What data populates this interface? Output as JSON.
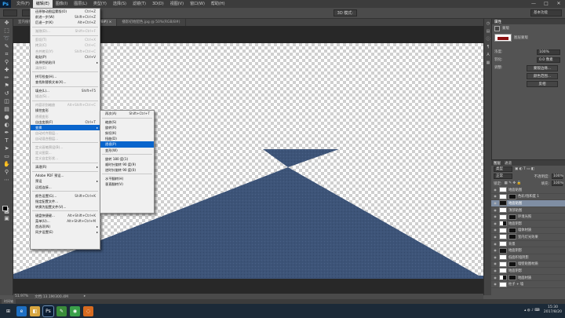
{
  "app": {
    "logo": "Ps"
  },
  "menubar": {
    "items": [
      "文件(F)",
      "编辑(E)",
      "图像(I)",
      "图层(L)",
      "类型(Y)",
      "选择(S)",
      "滤镜(T)",
      "3D(D)",
      "视图(V)",
      "窗口(W)",
      "帮助(H)"
    ],
    "active_index": 1,
    "window_buttons": [
      "—",
      "□",
      "✕"
    ]
  },
  "options_bar": {
    "mode_label": "3D 模式:",
    "workspace": "基本功能"
  },
  "doc_tabs": [
    {
      "label": "室内植物 @ 50% (RGB/8#)",
      "active": false
    },
    {
      "label": "@ 55.5% (RGB/8#) ×",
      "active": true
    },
    {
      "label": "播影初始配色.jpg @ 50%(RGB/8#)",
      "active": false
    }
  ],
  "edit_menu": [
    {
      "label": "还原移动图层蒙版(O)",
      "shortcut": "Ctrl+Z",
      "enabled": true
    },
    {
      "label": "前进一步(W)",
      "shortcut": "Shift+Ctrl+Z",
      "enabled": true
    },
    {
      "label": "后退一步(K)",
      "shortcut": "Alt+Ctrl+Z",
      "enabled": true
    },
    {
      "sep": true
    },
    {
      "label": "渐隐(D)...",
      "shortcut": "Shift+Ctrl+F",
      "enabled": false
    },
    {
      "sep": true
    },
    {
      "label": "剪切(T)",
      "shortcut": "Ctrl+X",
      "enabled": false
    },
    {
      "label": "拷贝(C)",
      "shortcut": "Ctrl+C",
      "enabled": false
    },
    {
      "label": "合并拷贝(Y)",
      "shortcut": "Shift+Ctrl+C",
      "enabled": false
    },
    {
      "label": "粘贴(P)",
      "shortcut": "Ctrl+V",
      "enabled": true
    },
    {
      "label": "选择性粘贴(I)",
      "shortcut": "",
      "enabled": true,
      "submenu": true
    },
    {
      "label": "清除(E)",
      "shortcut": "",
      "enabled": false
    },
    {
      "sep": true
    },
    {
      "label": "拼写检查(H)...",
      "shortcut": "",
      "enabled": true
    },
    {
      "label": "查找和替换文本(X)...",
      "shortcut": "",
      "enabled": true
    },
    {
      "sep": true
    },
    {
      "label": "填充(L)...",
      "shortcut": "Shift+F5",
      "enabled": true
    },
    {
      "label": "描边(S)...",
      "shortcut": "",
      "enabled": false
    },
    {
      "sep": true
    },
    {
      "label": "内容识别缩放",
      "shortcut": "Alt+Shift+Ctrl+C",
      "enabled": false
    },
    {
      "label": "操控变形",
      "shortcut": "",
      "enabled": true
    },
    {
      "label": "透视变形",
      "shortcut": "",
      "enabled": false
    },
    {
      "label": "自由变换(F)",
      "shortcut": "Ctrl+T",
      "enabled": true
    },
    {
      "label": "变换",
      "shortcut": "",
      "enabled": true,
      "submenu": true,
      "highlighted": true
    },
    {
      "label": "自动对齐图层...",
      "shortcut": "",
      "enabled": false
    },
    {
      "label": "自动混合图层...",
      "shortcut": "",
      "enabled": false
    },
    {
      "sep": true
    },
    {
      "label": "定义画笔预设(B)...",
      "shortcut": "",
      "enabled": false
    },
    {
      "label": "定义图案...",
      "shortcut": "",
      "enabled": false
    },
    {
      "label": "定义自定形状...",
      "shortcut": "",
      "enabled": false
    },
    {
      "sep": true
    },
    {
      "label": "清理(R)",
      "shortcut": "",
      "enabled": true,
      "submenu": true
    },
    {
      "sep": true
    },
    {
      "label": "Adobe PDF 预设...",
      "shortcut": "",
      "enabled": true
    },
    {
      "label": "预设",
      "shortcut": "",
      "enabled": true,
      "submenu": true
    },
    {
      "label": "远程连接...",
      "shortcut": "",
      "enabled": true
    },
    {
      "sep": true
    },
    {
      "label": "颜色设置(G)...",
      "shortcut": "Shift+Ctrl+K",
      "enabled": true
    },
    {
      "label": "指定配置文件...",
      "shortcut": "",
      "enabled": true
    },
    {
      "label": "转换为配置文件(V)...",
      "shortcut": "",
      "enabled": true
    },
    {
      "sep": true
    },
    {
      "label": "键盘快捷键...",
      "shortcut": "Alt+Shift+Ctrl+K",
      "enabled": true
    },
    {
      "label": "菜单(U)...",
      "shortcut": "Alt+Shift+Ctrl+M",
      "enabled": true
    },
    {
      "label": "首选项(N)",
      "shortcut": "",
      "enabled": true,
      "submenu": true
    },
    {
      "label": "同步设置(E)",
      "shortcut": "",
      "enabled": true,
      "submenu": true
    }
  ],
  "transform_submenu": [
    {
      "label": "再次(A)",
      "shortcut": "Shift+Ctrl+T",
      "enabled": true
    },
    {
      "sep": true
    },
    {
      "label": "缩放(S)",
      "shortcut": "",
      "enabled": true
    },
    {
      "label": "旋转(R)",
      "shortcut": "",
      "enabled": true
    },
    {
      "label": "斜切(K)",
      "shortcut": "",
      "enabled": true
    },
    {
      "label": "扭曲(D)",
      "shortcut": "",
      "enabled": true
    },
    {
      "label": "透视(P)",
      "shortcut": "",
      "enabled": true,
      "highlighted": true
    },
    {
      "label": "变形(W)",
      "shortcut": "",
      "enabled": true
    },
    {
      "sep": true
    },
    {
      "label": "旋转 180 度(1)",
      "shortcut": "",
      "enabled": true
    },
    {
      "label": "顺时针旋转 90 度(9)",
      "shortcut": "",
      "enabled": true
    },
    {
      "label": "逆时针旋转 90 度(0)",
      "shortcut": "",
      "enabled": true
    },
    {
      "sep": true
    },
    {
      "label": "水平翻转(H)",
      "shortcut": "",
      "enabled": true
    },
    {
      "label": "垂直翻转(V)",
      "shortcut": "",
      "enabled": true
    }
  ],
  "properties_panel": {
    "title": "属性",
    "mask_label": "蒙版",
    "layer_mask_label": "图层蒙版",
    "density_label": "浓度:",
    "density_value": "100%",
    "feather_label": "羽化:",
    "feather_value": "0.0 像素",
    "refine_label": "调整:",
    "buttons": [
      "蒙版边缘...",
      "颜色范围...",
      "反相"
    ]
  },
  "layers_panel": {
    "tabs": [
      "图层",
      "通道"
    ],
    "kind_label": "类型",
    "blend_mode": "正常",
    "opacity_label": "不透明度:",
    "opacity": "100%",
    "lock_label": "锁定:",
    "fill_label": "填充:",
    "fill": "100%",
    "layers": [
      {
        "name": "地面贴图",
        "thumb": "light",
        "mask": false,
        "selected": false
      },
      {
        "name": "色彩/饱和度 1",
        "thumb": "light",
        "mask": true,
        "selected": false
      },
      {
        "name": "地面贴图",
        "thumb": "dark",
        "mask": false,
        "selected": true
      },
      {
        "name": "顶部贴图",
        "thumb": "light",
        "mask": false,
        "selected": false
      },
      {
        "name": "环境光照",
        "thumb": "light",
        "mask": true,
        "selected": false
      },
      {
        "name": "地面阴影",
        "thumb": "half",
        "mask": false,
        "selected": false
      },
      {
        "name": "墙体材质",
        "thumb": "light",
        "mask": true,
        "selected": false
      },
      {
        "name": "室内灯光效果",
        "thumb": "light",
        "mask": true,
        "selected": false
      },
      {
        "name": "背景",
        "thumb": "light",
        "mask": false,
        "selected": false
      },
      {
        "name": "地面阴影",
        "thumb": "dark",
        "mask": false,
        "selected": false
      },
      {
        "name": "低面积墙阴影",
        "thumb": "light",
        "mask": false,
        "selected": false
      },
      {
        "name": "墙壁贴图材质",
        "thumb": "light",
        "mask": true,
        "selected": false
      },
      {
        "name": "地面阴影",
        "thumb": "light",
        "mask": false,
        "selected": false
      },
      {
        "name": "地面材质",
        "thumb": "half",
        "mask": true,
        "selected": false
      },
      {
        "name": "柱子 + 墙",
        "thumb": "light",
        "mask": false,
        "selected": false
      }
    ]
  },
  "status": {
    "zoom": "51.97%",
    "doc_info": "文档:13.1M/300.4M"
  },
  "mini_tab": "时间轴",
  "taskbar": {
    "icons": [
      "⊞",
      "e",
      "◧",
      "Ps",
      "✎",
      "◉",
      "◌"
    ],
    "active_index": 3,
    "time": "15:30",
    "date": "2017/8/20"
  },
  "colors": {
    "floor": "#3d5478",
    "menu_highlight": "#0a65cc",
    "layer_selected": "#7f8ea3"
  }
}
